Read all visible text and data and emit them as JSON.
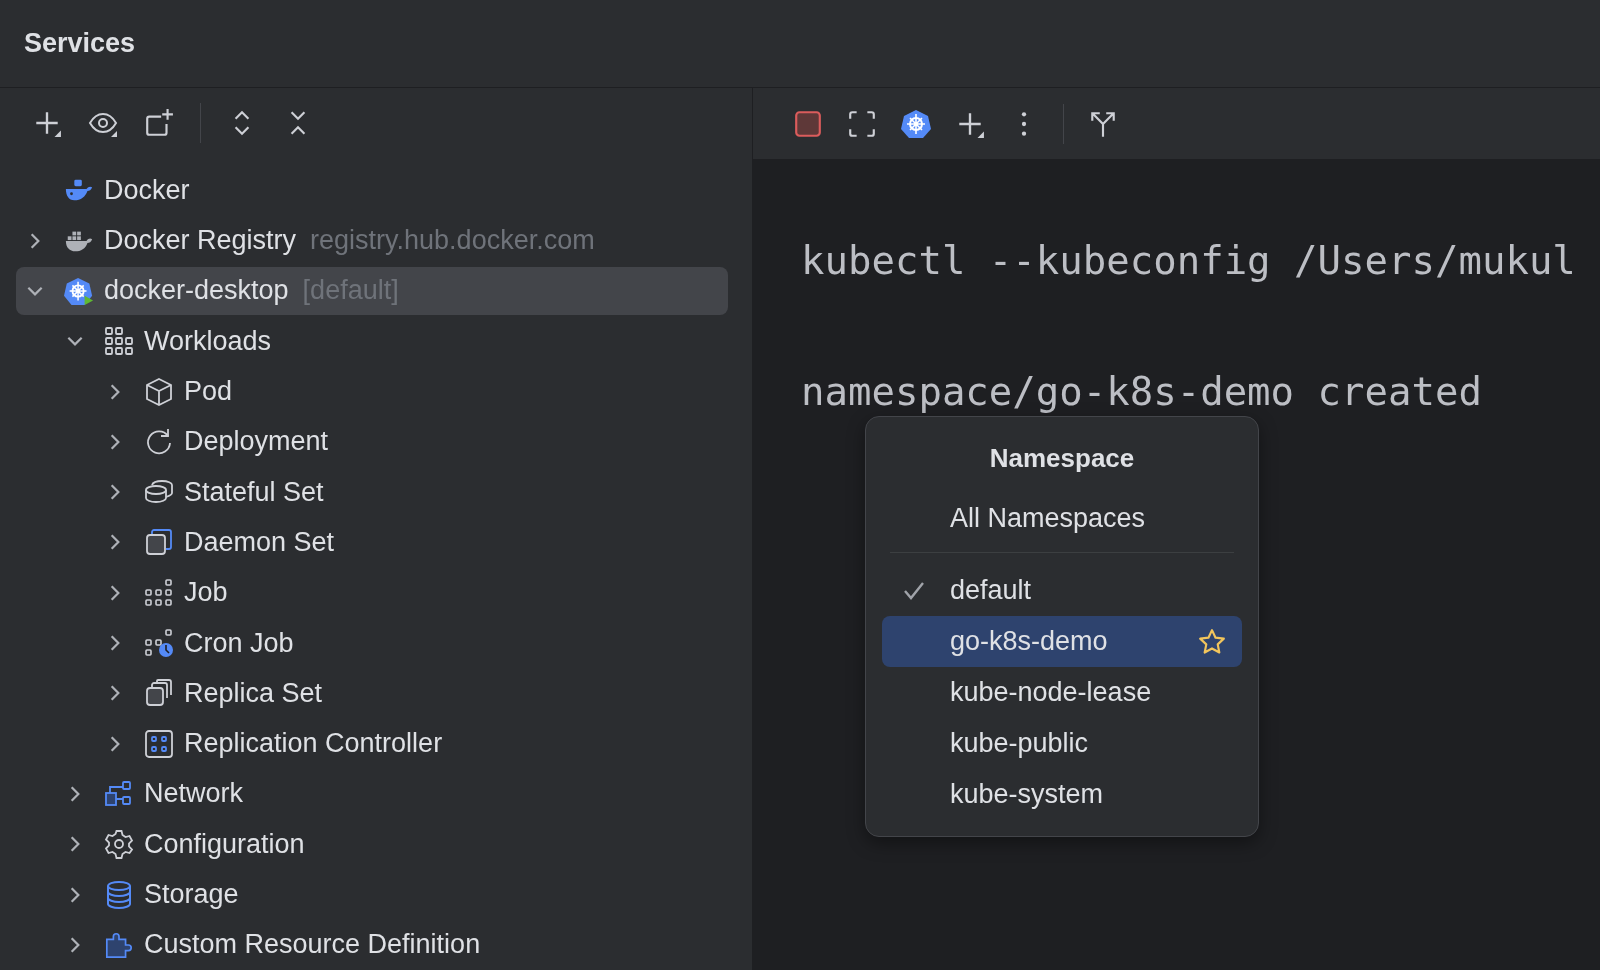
{
  "panel": {
    "title": "Services"
  },
  "tree": [
    {
      "label": "Docker",
      "kind": "docker",
      "leaf": true,
      "expanded": false,
      "selected": false
    },
    {
      "label": "Docker Registry",
      "detail": "registry.hub.docker.com",
      "kind": "registry",
      "leaf": false,
      "expanded": false,
      "selected": false
    },
    {
      "label": "docker-desktop",
      "detail": "[default]",
      "kind": "kubernetes",
      "leaf": false,
      "expanded": true,
      "selected": true,
      "children": [
        {
          "label": "Workloads",
          "kind": "workloads",
          "leaf": false,
          "expanded": true,
          "selected": false,
          "children": [
            {
              "label": "Pod",
              "kind": "pod",
              "leaf": false,
              "expanded": false,
              "selected": false
            },
            {
              "label": "Deployment",
              "kind": "deployment",
              "leaf": false,
              "expanded": false,
              "selected": false
            },
            {
              "label": "Stateful Set",
              "kind": "statefulset",
              "leaf": false,
              "expanded": false,
              "selected": false
            },
            {
              "label": "Daemon Set",
              "kind": "daemonset",
              "leaf": false,
              "expanded": false,
              "selected": false
            },
            {
              "label": "Job",
              "kind": "job",
              "leaf": false,
              "expanded": false,
              "selected": false
            },
            {
              "label": "Cron Job",
              "kind": "cronjob",
              "leaf": false,
              "expanded": false,
              "selected": false
            },
            {
              "label": "Replica Set",
              "kind": "replicaset",
              "leaf": false,
              "expanded": false,
              "selected": false
            },
            {
              "label": "Replication Controller",
              "kind": "replicationcontroller",
              "leaf": false,
              "expanded": false,
              "selected": false
            }
          ]
        },
        {
          "label": "Network",
          "kind": "network",
          "leaf": false,
          "expanded": false,
          "selected": false
        },
        {
          "label": "Configuration",
          "kind": "configuration",
          "leaf": false,
          "expanded": false,
          "selected": false
        },
        {
          "label": "Storage",
          "kind": "storage",
          "leaf": false,
          "expanded": false,
          "selected": false
        },
        {
          "label": "Custom Resource Definition",
          "kind": "crd",
          "leaf": false,
          "expanded": false,
          "selected": false
        }
      ]
    }
  ],
  "terminal": {
    "lines": [
      "kubectl --kubeconfig /Users/mukul",
      "namespace/go-k8s-demo created"
    ]
  },
  "namespace_popup": {
    "title": "Namespace",
    "all_option": {
      "label": "All Namespaces"
    },
    "namespaces": [
      {
        "label": "default",
        "checked": true,
        "selected": false,
        "starred": false
      },
      {
        "label": "go-k8s-demo",
        "checked": false,
        "selected": true,
        "starred": true
      },
      {
        "label": "kube-node-lease",
        "checked": false,
        "selected": false,
        "starred": false
      },
      {
        "label": "kube-public",
        "checked": false,
        "selected": false,
        "starred": false
      },
      {
        "label": "kube-system",
        "checked": false,
        "selected": false,
        "starred": false
      }
    ]
  }
}
